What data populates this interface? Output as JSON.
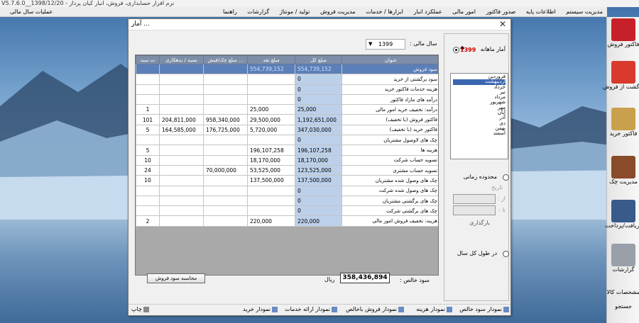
{
  "app_title": "V5.7.6.0__1398/12/20 - نرم افزار حسابداری، فروش، انبار کیان پرداز",
  "menu": {
    "items": [
      "مدیریت سیستم",
      "اطلاعات پایه",
      "صدور فاکتور",
      "امور مالی",
      "عملکرد انبار",
      "ابزارها / خدمات",
      "مدیریت فروش",
      "تولید / مونتاژ",
      "گزارشات",
      "راهنما"
    ],
    "left_label": "عملیات سال مالی"
  },
  "sidebar": [
    {
      "label": "فاکتور فروش",
      "icon": "sales-invoice-icon",
      "color": "#c8202a"
    },
    {
      "label": "برگشت از فروش",
      "icon": "sales-return-icon",
      "color": "#d93a2e"
    },
    {
      "label": "فاکتور خرید",
      "icon": "purchase-invoice-icon",
      "color": "#c9a14c"
    },
    {
      "label": "مدیریت چک",
      "icon": "check-management-icon",
      "color": "#8a4b2a"
    },
    {
      "label": "دریافت/پرداخت",
      "icon": "payment-icon",
      "color": "#3a5a8a"
    },
    {
      "label": "گزارشات",
      "icon": "reports-icon",
      "color": "#9aa0aa"
    },
    {
      "label": "مشخصات کالا",
      "icon": "product-specs-icon",
      "color": "#666666"
    },
    {
      "label": "جستجو",
      "icon": "search-icon",
      "color": "#666666"
    }
  ],
  "dialog": {
    "title": "آمار ...",
    "year_label": "سال مالی :",
    "year_value": "1399",
    "columns": [
      "ت سند",
      "نسیه / بدهکاری",
      "مبلغ چک/فیش ...",
      "مبلغ نقد",
      "مبلغ کل",
      "عنوان"
    ],
    "rows": [
      {
        "title": "سود فروش",
        "total": "554,739,152",
        "cash": "554,739,152",
        "check": "",
        "credit": "",
        "count": "",
        "selected": true
      },
      {
        "title": "سود برگشتی از خرید",
        "total": "0",
        "cash": "",
        "check": "",
        "credit": "",
        "count": ""
      },
      {
        "title": "هزینه خدمات فاکتور خرید",
        "total": "0",
        "cash": "",
        "check": "",
        "credit": "",
        "count": ""
      },
      {
        "title": "درآمد های مازاد فاکتور",
        "total": "0",
        "cash": "",
        "check": "",
        "credit": "",
        "count": ""
      },
      {
        "title": "درآمد: تخفیف خرید امور مالی",
        "total": "25,000",
        "cash": "25,000",
        "check": "",
        "credit": "",
        "count": "1"
      },
      {
        "title": "فاکتور فروش (با تخفیف)",
        "total": "1,192,651,000",
        "cash": "29,500,000",
        "check": "958,340,000",
        "credit": "204,811,000",
        "count": "101"
      },
      {
        "title": "فاکتور خرید (با تخفیف)",
        "total": "347,030,000",
        "cash": "5,720,000",
        "check": "176,725,000",
        "credit": "164,585,000",
        "count": "5"
      },
      {
        "title": "چک های لاوصول مشتریان",
        "total": "0",
        "cash": "",
        "check": "",
        "credit": "",
        "count": ""
      },
      {
        "title": "هزینه ها",
        "total": "196,107,258",
        "cash": "196,107,258",
        "check": "",
        "credit": "",
        "count": "5"
      },
      {
        "title": "تسویه حساب شرکت",
        "total": "18,170,000",
        "cash": "18,170,000",
        "check": "",
        "credit": "",
        "count": "10"
      },
      {
        "title": "تسویه حساب مشتری",
        "total": "123,525,000",
        "cash": "53,525,000",
        "check": "70,000,000",
        "credit": "",
        "count": "24"
      },
      {
        "title": "چک های وصول شده مشتریان",
        "total": "137,500,000",
        "cash": "137,500,000",
        "check": "",
        "credit": "",
        "count": "10"
      },
      {
        "title": "چک های وصول شده شرکت",
        "total": "0",
        "cash": "",
        "check": "",
        "credit": "",
        "count": ""
      },
      {
        "title": "چک های برگشتی مشتریان",
        "total": "0",
        "cash": "",
        "check": "",
        "credit": "",
        "count": ""
      },
      {
        "title": "چک های برگشتی شرکت",
        "total": "0",
        "cash": "",
        "check": "",
        "credit": "",
        "count": ""
      },
      {
        "title": "هزینه: تخفیف فروش امور مالی",
        "total": "220,000",
        "cash": "220,000",
        "check": "",
        "credit": "",
        "count": "2"
      }
    ],
    "right_panel": {
      "monthly_label": "آمار ماهانه",
      "monthly_year": "1399",
      "months": [
        "فروردین",
        "اردیبهشت",
        "خرداد",
        "تیر",
        "مرداد",
        "شهریور",
        "مهر",
        "آبان",
        "آذر",
        "دی",
        "بهمن",
        "اسفند"
      ],
      "selected_month_index": 1,
      "date_range_label": "محدوده زمانی",
      "from_label": "از :",
      "to_label": "تا :",
      "date_label": "تاریخ",
      "refresh_label": "بارگذاری",
      "whole_year_label": "در طول کل سال"
    },
    "net_profit_label": "سود خالص :",
    "net_profit_value": "358,436,894",
    "currency": "ریال",
    "calc_button": "محاسبه سود فروش",
    "toolbar": [
      "نمودار سود خالص",
      "نمودار هزینه",
      "نمودار فروش باخالص",
      "نمودار ارائه خدمات",
      "نمودار خرید"
    ],
    "print_label": "چاپ"
  }
}
